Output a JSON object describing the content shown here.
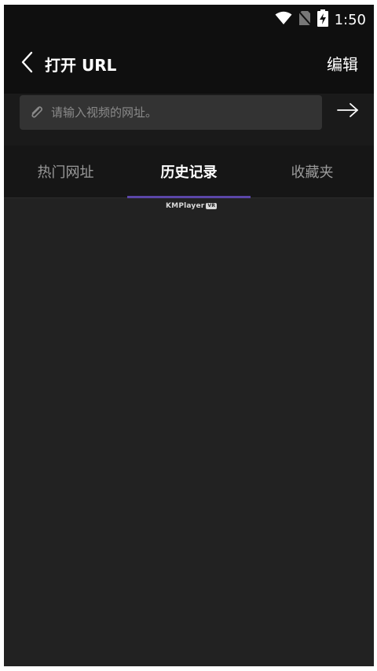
{
  "status_bar": {
    "time": "1:50",
    "icons": [
      "wifi-icon",
      "no-sim-icon",
      "battery-charging-icon"
    ]
  },
  "app_bar": {
    "title": "打开 URL",
    "edit_label": "编辑",
    "back_icon": "chevron-left-icon"
  },
  "url_bar": {
    "placeholder": "请输入视频的网址。",
    "value": "",
    "link_icon": "link-icon",
    "go_icon": "arrow-right-icon"
  },
  "tabs": [
    {
      "label": "热门网址",
      "active": false
    },
    {
      "label": "历史记录",
      "active": true
    },
    {
      "label": "收藏夹",
      "active": false
    }
  ],
  "watermark": {
    "text": "KMPlayer",
    "badge": "VR"
  },
  "colors": {
    "background": "#222222",
    "header": "#0f0f0f",
    "input_bg": "#333333",
    "accent": "#5b46a8",
    "inactive_tab": "#9a9a9a"
  }
}
